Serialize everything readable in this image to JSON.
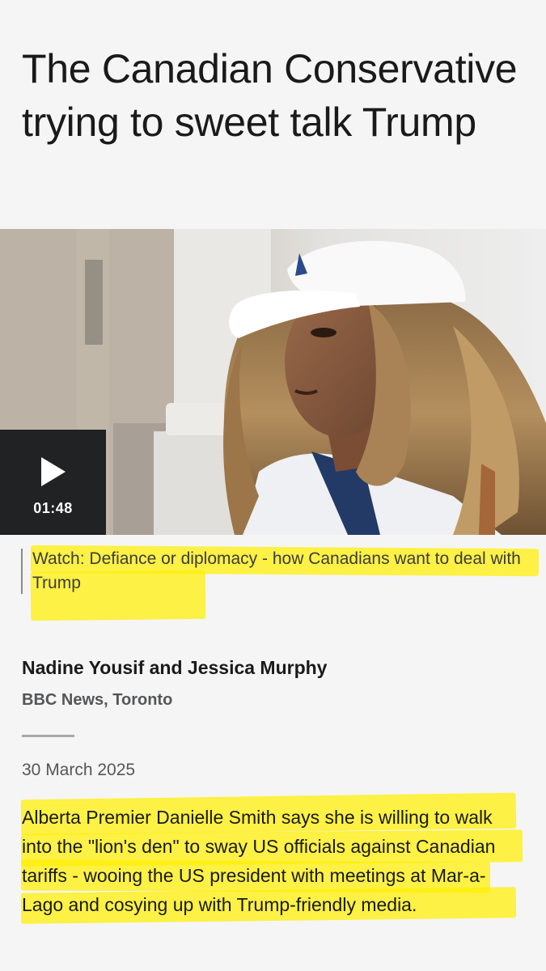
{
  "article": {
    "headline": "The Canadian Conservative trying to sweet talk Trump",
    "media": {
      "duration": "01:48",
      "caption": "Watch: Defiance or diplomacy - how Canadians want to deal with Trump"
    },
    "byline": {
      "authors": "Nadine Yousif and Jessica Murphy",
      "source": "BBC News, Toronto"
    },
    "date": "30 March 2025",
    "lead_paragraph": "Alberta Premier Danielle Smith says she is willing to walk into the \"lion's den\" to sway US officials against Canadian tariffs - wooing the US president with meetings at Mar-a-Lago and cosying up with Trump-friendly media."
  },
  "colors": {
    "highlight": "#fff000",
    "play_box": "#202224",
    "page_background": "#f5f5f5"
  },
  "icons": {
    "play": "play-icon"
  }
}
